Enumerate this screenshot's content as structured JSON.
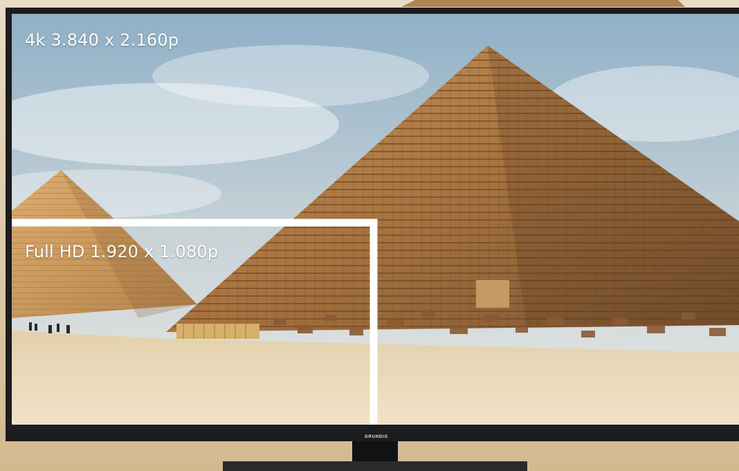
{
  "labels": {
    "uhd": "4k 3.840 x 2.160p",
    "fhd": "Full HD 1.920 x 1.080p"
  },
  "tv": {
    "brand": "GRUNDIG",
    "bezel_color": "#1c1d1f",
    "stand_color": "#111214"
  },
  "colors": {
    "sky_top": "#8fb0c6",
    "sky_bottom": "#e4e7e6",
    "stone_light": "#c89a5b",
    "stone_dark": "#7a5430",
    "sand": "#ead8b8",
    "frame": "#ffffff"
  }
}
